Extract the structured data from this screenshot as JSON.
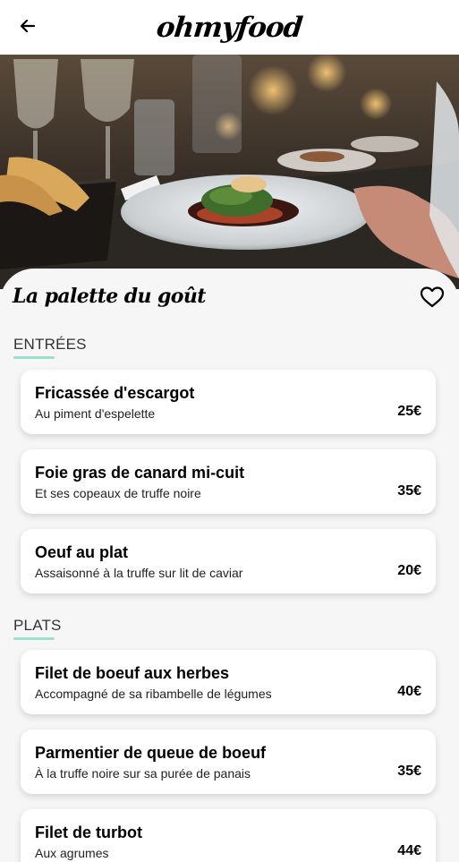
{
  "header": {
    "logo": "ohmyfood",
    "back_icon": "arrow-left-icon"
  },
  "restaurant": {
    "name": "La palette du goût",
    "favorite_icon": "heart-outline-icon"
  },
  "sections": [
    {
      "title": "ENTRÉES",
      "items": [
        {
          "name": "Fricassée d'escargot",
          "description": "Au piment d'espelette",
          "price": "25€"
        },
        {
          "name": "Foie gras de canard mi-cuit",
          "description": "Et ses copeaux de truffe noire",
          "price": "35€"
        },
        {
          "name": "Oeuf au plat",
          "description": "Assaisonné à la truffe sur lit de caviar",
          "price": "20€"
        }
      ]
    },
    {
      "title": "PLATS",
      "items": [
        {
          "name": "Filet de boeuf aux herbes",
          "description": "Accompagné de sa ribambelle de légumes",
          "price": "40€"
        },
        {
          "name": "Parmentier de queue de boeuf",
          "description": "À la truffe noire sur sa purée de panais",
          "price": "35€"
        },
        {
          "name": "Filet de turbot",
          "description": "Aux agrumes",
          "price": "44€"
        }
      ]
    }
  ],
  "colors": {
    "accent": "#99e2d0",
    "background": "#f6f6f6",
    "card": "#ffffff"
  }
}
